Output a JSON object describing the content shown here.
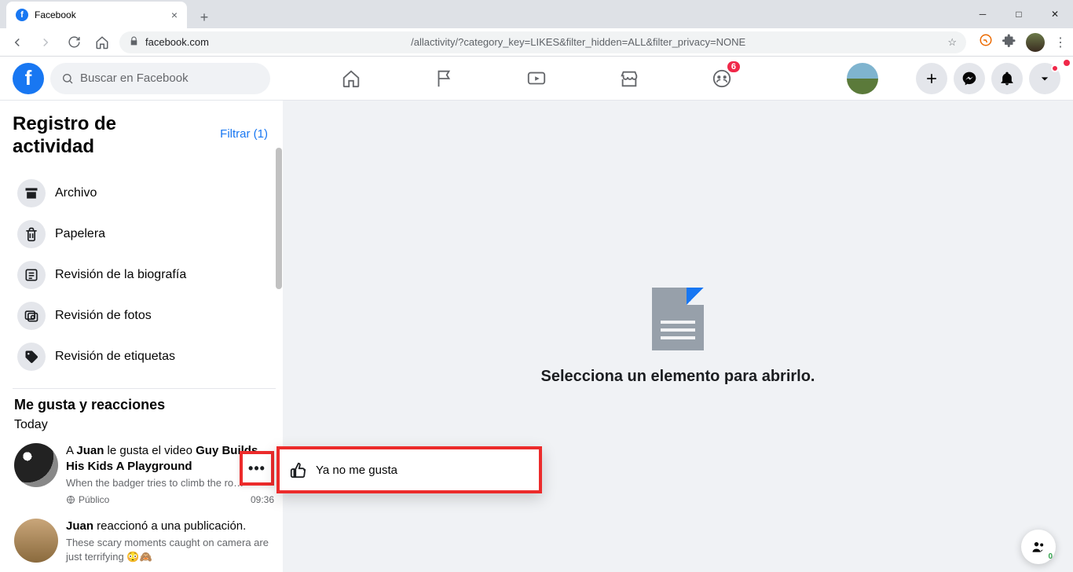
{
  "browser": {
    "tab_title": "Facebook",
    "address_domain": "facebook.com",
    "address_path": "/allactivity/?category_key=LIKES&filter_hidden=ALL&filter_privacy=NONE"
  },
  "header": {
    "search_placeholder": "Buscar en Facebook",
    "groups_badge": "6"
  },
  "sidebar": {
    "title": "Registro de actividad",
    "filter_label": "Filtrar (1)",
    "items": [
      {
        "label": "Archivo"
      },
      {
        "label": "Papelera"
      },
      {
        "label": "Revisión de la biografía"
      },
      {
        "label": "Revisión de fotos"
      },
      {
        "label": "Revisión de etiquetas"
      }
    ],
    "section_label": "Me gusta y reacciones",
    "day_label": "Today"
  },
  "activity": [
    {
      "prefix": "A ",
      "user": "Juan",
      "middle": " le gusta el video ",
      "title": "Guy Builds His Kids A Playground",
      "desc": "When the badger tries to climb the ro…",
      "privacy": "Público",
      "time": "09:36"
    },
    {
      "user": "Juan",
      "middle": " reaccionó a una publicación.",
      "desc": "These scary moments caught on camera are just terrifying 😳🙈"
    }
  ],
  "context_menu": {
    "unlike_label": "Ya no me gusta"
  },
  "main": {
    "empty": "Selecciona un elemento para abrirlo."
  },
  "floating": {
    "count": "0"
  }
}
